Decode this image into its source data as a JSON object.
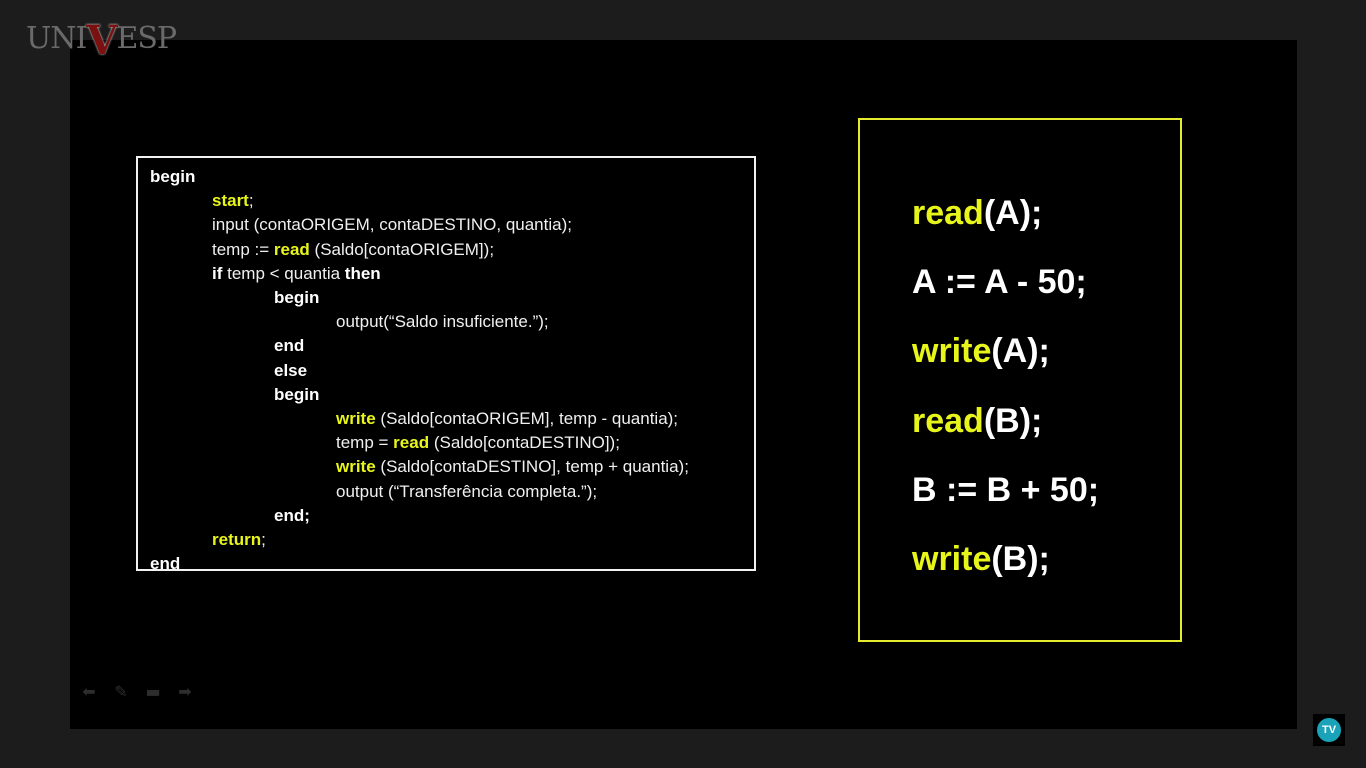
{
  "branding": {
    "logo_left": "UNI",
    "logo_v": "V",
    "logo_right": "ESP",
    "tv_badge": "TV"
  },
  "code": {
    "lines": [
      [
        {
          "t": "begin",
          "s": "kw-white"
        }
      ],
      [
        {
          "t": "start",
          "s": "kw-yellow"
        },
        {
          "t": ";",
          "s": "plain"
        }
      ],
      [
        {
          "t": "input (contaORIGEM, contaDESTINO, quantia);",
          "s": "plain"
        }
      ],
      [
        {
          "t": "temp := ",
          "s": "plain"
        },
        {
          "t": "read",
          "s": "kw-yellow"
        },
        {
          "t": " (Saldo[contaORIGEM]);",
          "s": "plain"
        }
      ],
      [
        {
          "t": "if",
          "s": "kw-white"
        },
        {
          "t": " temp < quantia ",
          "s": "plain"
        },
        {
          "t": "then",
          "s": "kw-white"
        }
      ],
      [
        {
          "t": "begin",
          "s": "kw-white"
        }
      ],
      [
        {
          "t": "output(“Saldo insuficiente.”);",
          "s": "plain"
        }
      ],
      [
        {
          "t": "end",
          "s": "kw-white"
        }
      ],
      [
        {
          "t": "else",
          "s": "kw-white"
        }
      ],
      [
        {
          "t": "begin",
          "s": "kw-white"
        }
      ],
      [
        {
          "t": "write",
          "s": "kw-yellow"
        },
        {
          "t": " (Saldo[contaORIGEM], temp - quantia);",
          "s": "plain"
        }
      ],
      [
        {
          "t": "temp = ",
          "s": "plain"
        },
        {
          "t": "read",
          "s": "kw-yellow"
        },
        {
          "t": " (Saldo[contaDESTINO]);",
          "s": "plain"
        }
      ],
      [
        {
          "t": "write",
          "s": "kw-yellow"
        },
        {
          "t": " (Saldo[contaDESTINO], temp + quantia);",
          "s": "plain"
        }
      ],
      [
        {
          "t": "output (“Transferência completa.”);",
          "s": "plain"
        }
      ],
      [
        {
          "t": "end;",
          "s": "kw-white"
        }
      ],
      [
        {
          "t": "return",
          "s": "kw-yellow"
        },
        {
          "t": ";",
          "s": "plain"
        }
      ],
      [
        {
          "t": "end",
          "s": "kw-white"
        }
      ]
    ],
    "indent_levels": [
      0,
      1,
      1,
      1,
      1,
      2,
      3,
      2,
      2,
      2,
      3,
      3,
      3,
      3,
      2,
      1,
      0
    ]
  },
  "operations": [
    [
      {
        "t": "read",
        "s": "op-yellow"
      },
      {
        "t": "(A);",
        "s": ""
      }
    ],
    [
      {
        "t": "A := A - 50;",
        "s": ""
      }
    ],
    [
      {
        "t": "write",
        "s": "op-yellow"
      },
      {
        "t": "(A);",
        "s": ""
      }
    ],
    [
      {
        "t": "read",
        "s": "op-yellow"
      },
      {
        "t": "(B);",
        "s": ""
      }
    ],
    [
      {
        "t": "B := B + 50;",
        "s": ""
      }
    ],
    [
      {
        "t": "write",
        "s": "op-yellow"
      },
      {
        "t": "(B);",
        "s": ""
      }
    ]
  ],
  "nav": [
    {
      "name": "previous-slide-button",
      "glyph": "⬅"
    },
    {
      "name": "pen-tool-button",
      "glyph": "✎"
    },
    {
      "name": "slides-menu-button",
      "glyph": "▬"
    },
    {
      "name": "next-slide-button",
      "glyph": "➡"
    }
  ],
  "colors": {
    "accent_yellow": "#e8f51a",
    "code_border": "#f2f2f2",
    "ops_border": "#e5ec2f",
    "slide_bg": "#000000",
    "frame_bg": "#1c1c1c",
    "tv_badge": "#1aa3b8"
  }
}
